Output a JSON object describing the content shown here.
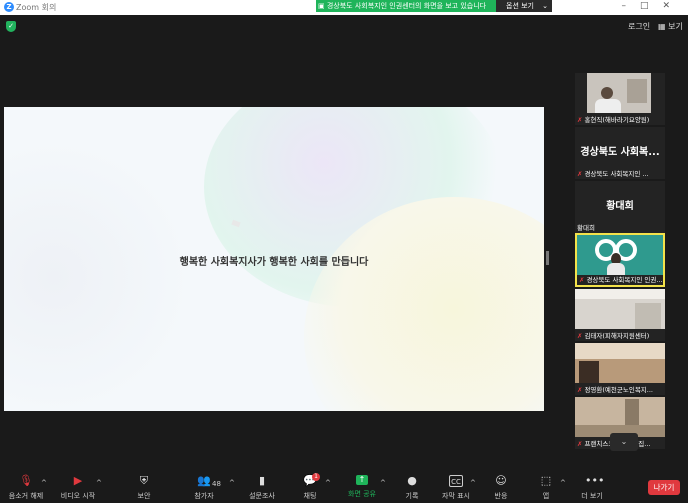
{
  "titlebar": {
    "app_name": "Zoom 회의",
    "share_banner": "경상북도 사회복지인 인권센터의 화면을 보고 있습니다",
    "view_options": "옵션 보기"
  },
  "header": {
    "login": "로그인",
    "view": "보기"
  },
  "slide": {
    "text": "행복한 사회복지사가 행복한 사회를 만듭니다"
  },
  "gallery": {
    "tiles": [
      {
        "label": "홍현직(해바라기요양원)"
      },
      {
        "big": "경상북도 사회복...",
        "label": "경상북도 사회복지인 ..."
      },
      {
        "big": "황대희",
        "label": "황대희"
      },
      {
        "label": "경상북도 사회복지인 인권..."
      },
      {
        "label": "김태자(피해자지원센터)"
      },
      {
        "label": "정영환(예천군노인복지..."
      },
      {
        "label": "프랜치스코청소년의집..."
      }
    ]
  },
  "toolbar": {
    "mute": "음소거 해제",
    "video": "비디오 시작",
    "security": "보안",
    "participants": "참가자",
    "participants_count": "48",
    "polls": "설문조사",
    "chat": "채팅",
    "chat_badge": "1",
    "share": "화면 공유",
    "record": "기록",
    "captions": "자막 표시",
    "reactions": "반응",
    "apps": "앱",
    "more": "더 보기",
    "leave": "나가기"
  },
  "colors": {
    "accent_green": "#1fb45a",
    "leave_red": "#e0393e",
    "active_speaker": "#f3e24a"
  }
}
